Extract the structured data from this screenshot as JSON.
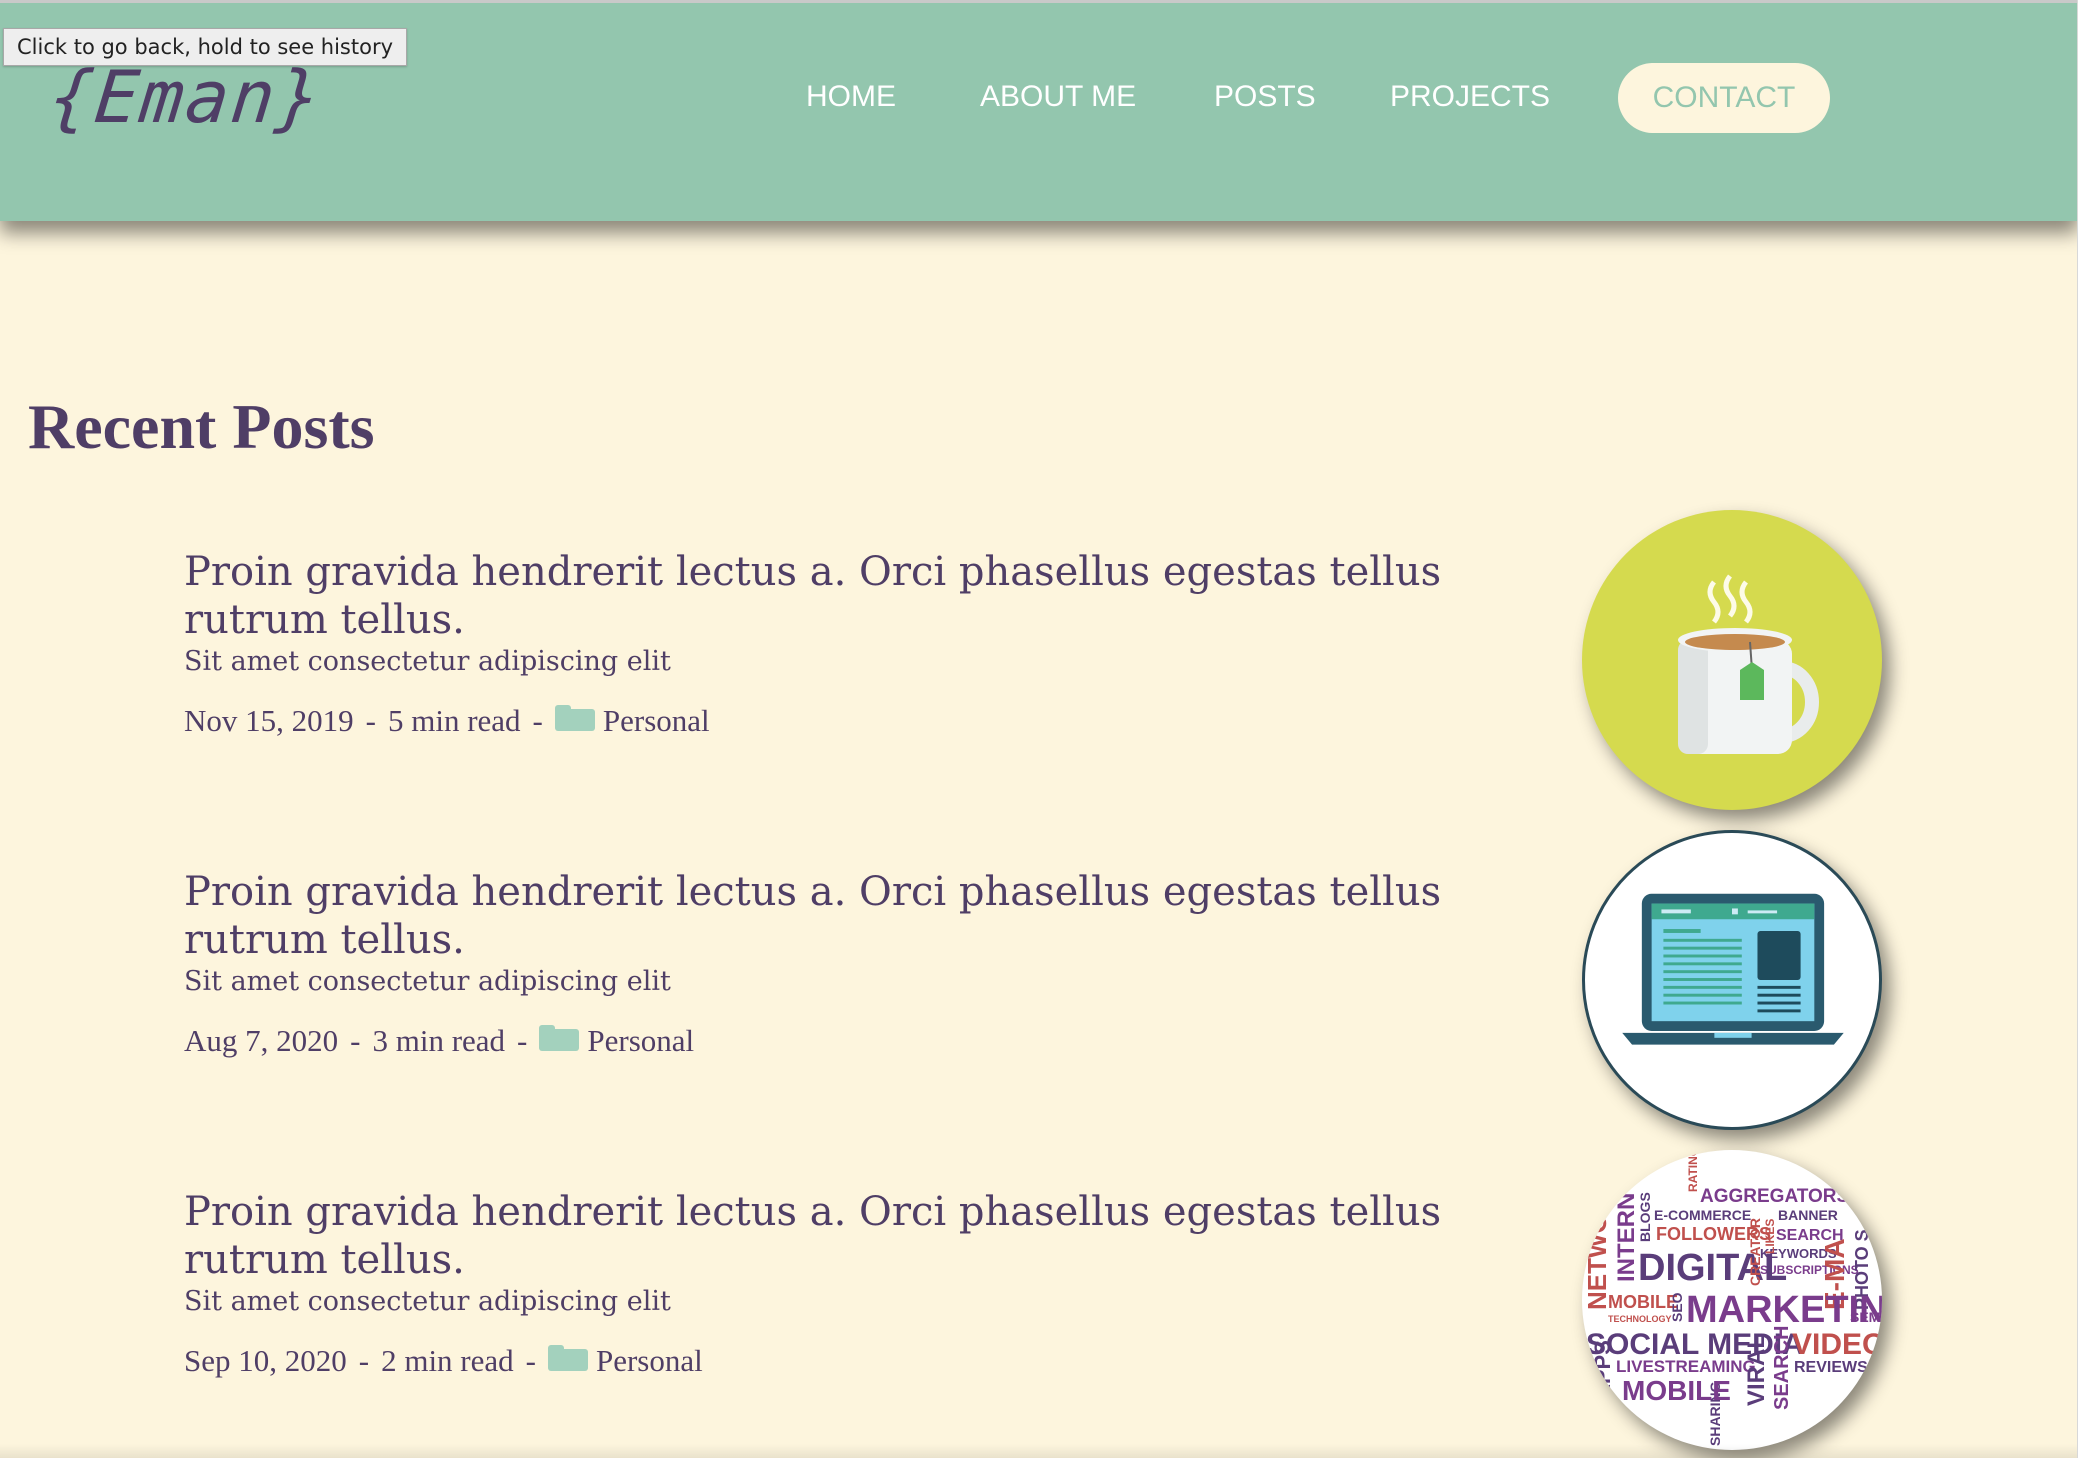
{
  "browser": {
    "tooltip": "Click to go back, hold to see history"
  },
  "header": {
    "logo": "{Eman}",
    "nav": {
      "home": "HOME",
      "about": "ABOUT ME",
      "posts": "POSTS",
      "projects": "PROJECTS",
      "contact": "CONTACT"
    }
  },
  "main": {
    "title": "Recent Posts",
    "posts": [
      {
        "title": "Proin gravida hendrerit lectus a. Orci phasellus egestas tellus rutrum tellus.",
        "subtitle": "Sit amet consectetur adipiscing elit",
        "date": "Nov 15, 2019",
        "read_time": "5 min read",
        "category": "Personal",
        "thumbnail": "tea-mug-icon"
      },
      {
        "title": "Proin gravida hendrerit lectus a. Orci phasellus egestas tellus rutrum tellus.",
        "subtitle": "Sit amet consectetur adipiscing elit",
        "date": "Aug 7, 2020",
        "read_time": "3 min read",
        "category": "Personal",
        "thumbnail": "laptop-icon"
      },
      {
        "title": "Proin gravida hendrerit lectus a. Orci phasellus egestas tellus rutrum tellus.",
        "subtitle": "Sit amet consectetur adipiscing elit",
        "date": "Sep 10, 2020",
        "read_time": "2 min read",
        "category": "Personal",
        "thumbnail": "marketing-word-cloud"
      }
    ],
    "separator": "-"
  },
  "word_cloud": {
    "words": [
      "RATINGS",
      "AGGREGATORS",
      "E-COMMERCE",
      "BANNER",
      "BLOGS",
      "FOLLOWERS",
      "SEARCH",
      "KEYWORDS",
      "SUBSCRIPTIONS",
      "NETWORK",
      "INTERN",
      "DIGITAL",
      "CREATOR",
      "LIKES",
      "E-MA",
      "PHOTO S",
      "MOBILE",
      "TECHNOLOGY",
      "SEO",
      "MARKETING",
      "SEM",
      "SOCIAL MEDIA",
      "VIDEOS",
      "APPS",
      "LIVESTREAMING",
      "REVIEWS",
      "VIRAL",
      "SEARCH",
      "SHARING"
    ]
  },
  "colors": {
    "header_bg": "#93c6ae",
    "page_bg": "#fdf5dd",
    "text": "#4f3e66",
    "folder": "#a3d1bd",
    "mug_bg": "#d5da4e",
    "laptop_border": "#2a4a57"
  }
}
